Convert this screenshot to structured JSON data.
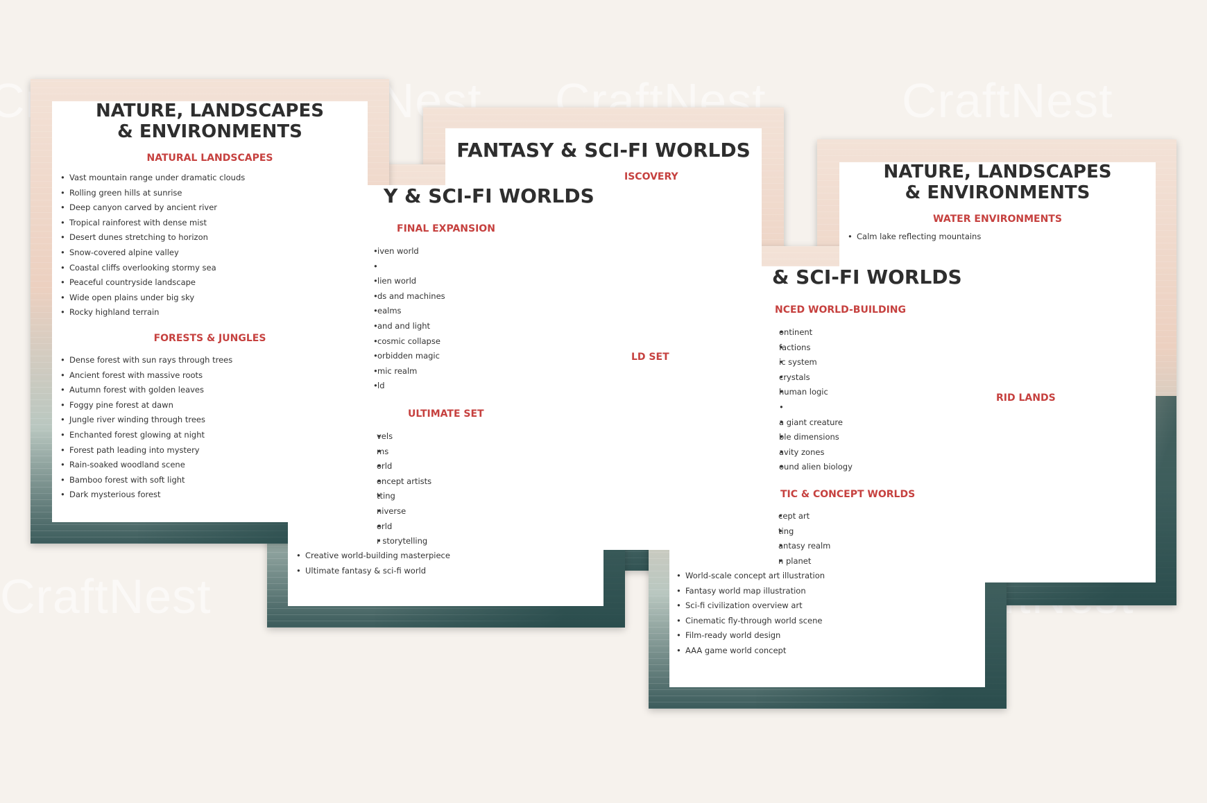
{
  "watermark": "CraftNest",
  "sheet1": {
    "title_line1": "NATURE, LANDSCAPES",
    "title_line2": "& ENVIRONMENTS",
    "section1": "NATURAL LANDSCAPES",
    "items1": [
      "Vast mountain range under dramatic clouds",
      "Rolling green hills at sunrise",
      "Deep canyon carved by ancient river",
      "Tropical rainforest with dense mist",
      "Desert dunes stretching to horizon",
      "Snow-covered alpine valley",
      "Coastal cliffs overlooking stormy sea",
      "Peaceful countryside landscape",
      "Wide open plains under big sky",
      "Rocky highland terrain"
    ],
    "section2": "FORESTS & JUNGLES",
    "items2": [
      "Dense forest with sun rays through trees",
      "Ancient forest with massive roots",
      "Autumn forest with golden leaves",
      "Foggy pine forest at dawn",
      "Jungle river winding through trees",
      "Enchanted forest glowing at night",
      "Forest path leading into mystery",
      "Rain-soaked woodland scene",
      "Bamboo forest with soft light",
      "Dark mysterious forest"
    ]
  },
  "sheet2": {
    "title": "Y & SCI-FI WORLDS",
    "section1": "FINAL EXPANSION",
    "items1": [
      "iven world",
      "",
      "lien world",
      "ds and machines",
      "ealms",
      "and and light",
      " cosmic collapse",
      "orbidden magic",
      "mic realm",
      "ld"
    ],
    "section2": "ULTIMATE SET",
    "items2": [
      "vels",
      "ms",
      "orld",
      "oncept artists",
      "tting",
      "niverse",
      "orld",
      "r storytelling"
    ],
    "items3": [
      "Creative world-building masterpiece",
      "Ultimate fantasy & sci-fi world"
    ]
  },
  "sheet3": {
    "title": "FANTASY & SCI-FI WORLDS",
    "section1": "ISCOVERY",
    "section2": "LD SET"
  },
  "sheet4": {
    "title_line1": "NATURE, LANDSCAPES",
    "title_line2": "& ENVIRONMENTS",
    "section1": "WATER ENVIRONMENTS",
    "items1": [
      "Calm lake reflecting mountains"
    ],
    "section2": "RID LANDS"
  },
  "sheet5": {
    "title": "& SCI-FI WORLDS",
    "section1": "NCED WORLD-BUILDING",
    "items1": [
      "ontinent",
      "factions",
      "ic system",
      "crystals",
      "human logic",
      "",
      "a giant creature",
      "ble dimensions",
      "avity zones",
      "ound alien biology"
    ],
    "section2": "TIC & CONCEPT WORLDS",
    "items2": [
      "cept art",
      "ting",
      "antasy realm",
      "n planet"
    ],
    "items3": [
      "World-scale concept art illustration",
      "Fantasy world map illustration",
      "Sci-fi civilization overview art",
      "Cinematic fly-through world scene",
      "Film-ready world design",
      "AAA game world concept"
    ]
  }
}
